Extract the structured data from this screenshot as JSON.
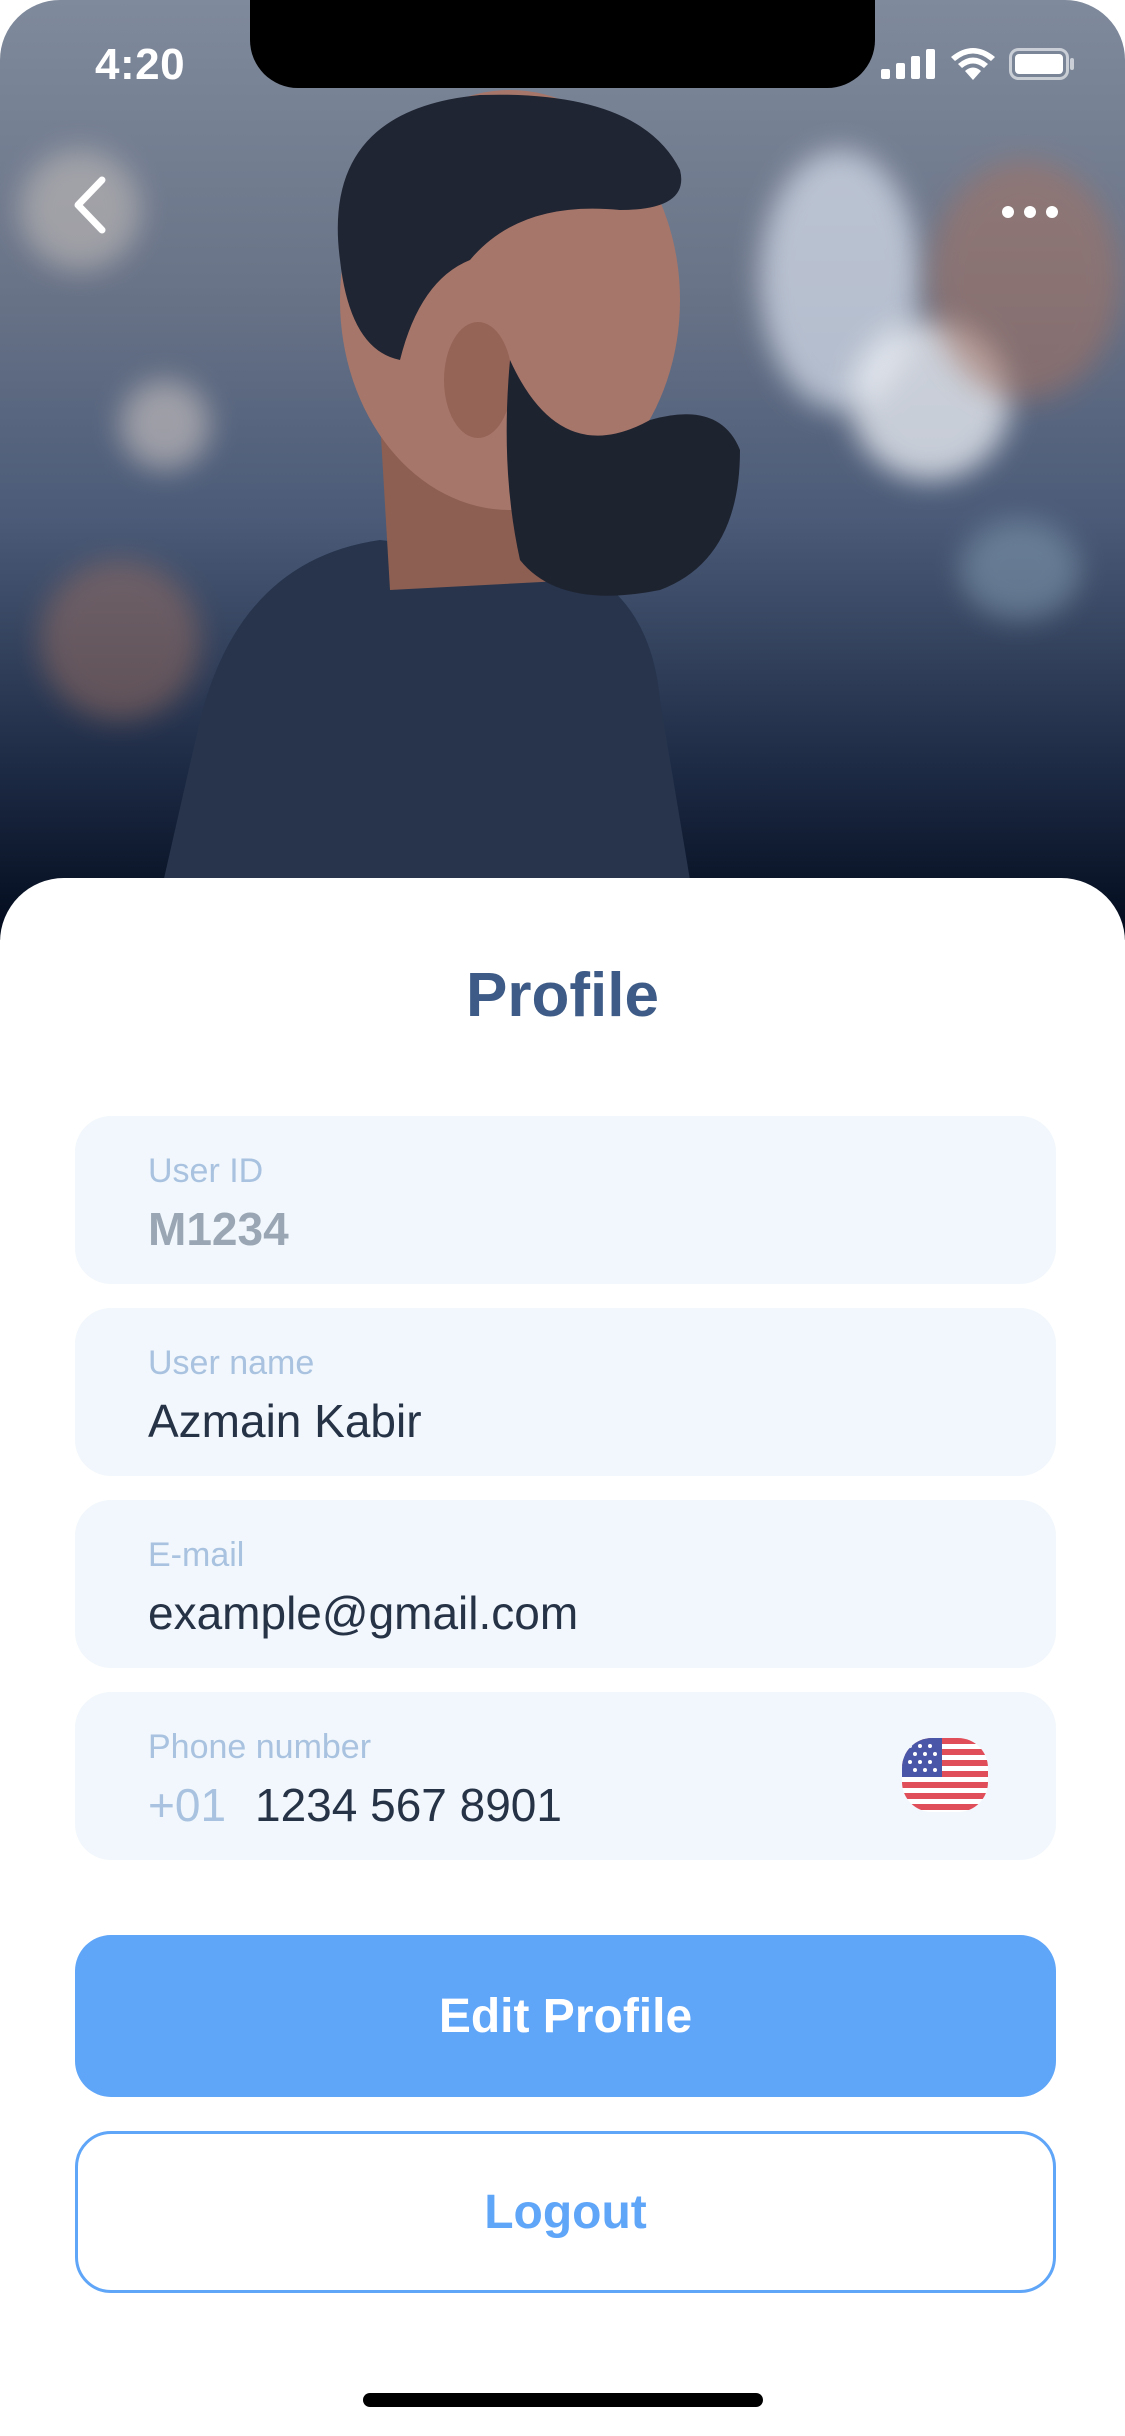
{
  "status_bar": {
    "time": "4:20"
  },
  "header": {
    "back_icon": "chevron-left-icon",
    "more_icon": "more-horizontal-icon"
  },
  "profile": {
    "title": "Profile",
    "fields": [
      {
        "label": "User ID",
        "value": "M1234"
      },
      {
        "label": "User name",
        "value": "Azmain Kabir"
      },
      {
        "label": "E-mail",
        "value": "example@gmail.com"
      },
      {
        "label": "Phone number",
        "prefix": "+01",
        "value": "1234 567 8901",
        "flag_icon": "us-flag-icon"
      }
    ]
  },
  "actions": {
    "edit_label": "Edit Profile",
    "logout_label": "Logout"
  },
  "colors": {
    "accent": "#5fa5f8",
    "title": "#3d5b86",
    "field_bg": "#f1f7fc",
    "label": "#a8c2df"
  }
}
